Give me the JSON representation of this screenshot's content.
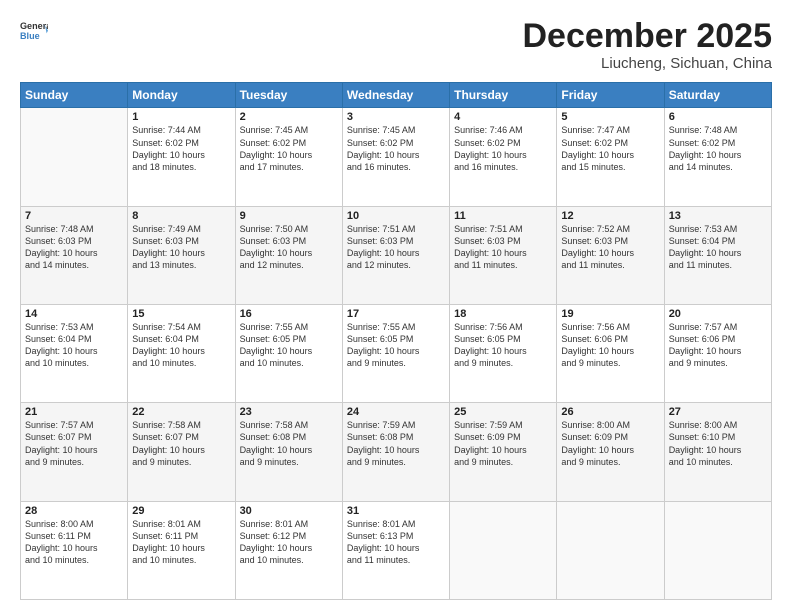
{
  "header": {
    "logo_general": "General",
    "logo_blue": "Blue",
    "month": "December 2025",
    "location": "Liucheng, Sichuan, China"
  },
  "weekdays": [
    "Sunday",
    "Monday",
    "Tuesday",
    "Wednesday",
    "Thursday",
    "Friday",
    "Saturday"
  ],
  "weeks": [
    [
      {
        "day": "",
        "info": ""
      },
      {
        "day": "1",
        "info": "Sunrise: 7:44 AM\nSunset: 6:02 PM\nDaylight: 10 hours\nand 18 minutes."
      },
      {
        "day": "2",
        "info": "Sunrise: 7:45 AM\nSunset: 6:02 PM\nDaylight: 10 hours\nand 17 minutes."
      },
      {
        "day": "3",
        "info": "Sunrise: 7:45 AM\nSunset: 6:02 PM\nDaylight: 10 hours\nand 16 minutes."
      },
      {
        "day": "4",
        "info": "Sunrise: 7:46 AM\nSunset: 6:02 PM\nDaylight: 10 hours\nand 16 minutes."
      },
      {
        "day": "5",
        "info": "Sunrise: 7:47 AM\nSunset: 6:02 PM\nDaylight: 10 hours\nand 15 minutes."
      },
      {
        "day": "6",
        "info": "Sunrise: 7:48 AM\nSunset: 6:02 PM\nDaylight: 10 hours\nand 14 minutes."
      }
    ],
    [
      {
        "day": "7",
        "info": "Sunrise: 7:48 AM\nSunset: 6:03 PM\nDaylight: 10 hours\nand 14 minutes."
      },
      {
        "day": "8",
        "info": "Sunrise: 7:49 AM\nSunset: 6:03 PM\nDaylight: 10 hours\nand 13 minutes."
      },
      {
        "day": "9",
        "info": "Sunrise: 7:50 AM\nSunset: 6:03 PM\nDaylight: 10 hours\nand 12 minutes."
      },
      {
        "day": "10",
        "info": "Sunrise: 7:51 AM\nSunset: 6:03 PM\nDaylight: 10 hours\nand 12 minutes."
      },
      {
        "day": "11",
        "info": "Sunrise: 7:51 AM\nSunset: 6:03 PM\nDaylight: 10 hours\nand 11 minutes."
      },
      {
        "day": "12",
        "info": "Sunrise: 7:52 AM\nSunset: 6:03 PM\nDaylight: 10 hours\nand 11 minutes."
      },
      {
        "day": "13",
        "info": "Sunrise: 7:53 AM\nSunset: 6:04 PM\nDaylight: 10 hours\nand 11 minutes."
      }
    ],
    [
      {
        "day": "14",
        "info": "Sunrise: 7:53 AM\nSunset: 6:04 PM\nDaylight: 10 hours\nand 10 minutes."
      },
      {
        "day": "15",
        "info": "Sunrise: 7:54 AM\nSunset: 6:04 PM\nDaylight: 10 hours\nand 10 minutes."
      },
      {
        "day": "16",
        "info": "Sunrise: 7:55 AM\nSunset: 6:05 PM\nDaylight: 10 hours\nand 10 minutes."
      },
      {
        "day": "17",
        "info": "Sunrise: 7:55 AM\nSunset: 6:05 PM\nDaylight: 10 hours\nand 9 minutes."
      },
      {
        "day": "18",
        "info": "Sunrise: 7:56 AM\nSunset: 6:05 PM\nDaylight: 10 hours\nand 9 minutes."
      },
      {
        "day": "19",
        "info": "Sunrise: 7:56 AM\nSunset: 6:06 PM\nDaylight: 10 hours\nand 9 minutes."
      },
      {
        "day": "20",
        "info": "Sunrise: 7:57 AM\nSunset: 6:06 PM\nDaylight: 10 hours\nand 9 minutes."
      }
    ],
    [
      {
        "day": "21",
        "info": "Sunrise: 7:57 AM\nSunset: 6:07 PM\nDaylight: 10 hours\nand 9 minutes."
      },
      {
        "day": "22",
        "info": "Sunrise: 7:58 AM\nSunset: 6:07 PM\nDaylight: 10 hours\nand 9 minutes."
      },
      {
        "day": "23",
        "info": "Sunrise: 7:58 AM\nSunset: 6:08 PM\nDaylight: 10 hours\nand 9 minutes."
      },
      {
        "day": "24",
        "info": "Sunrise: 7:59 AM\nSunset: 6:08 PM\nDaylight: 10 hours\nand 9 minutes."
      },
      {
        "day": "25",
        "info": "Sunrise: 7:59 AM\nSunset: 6:09 PM\nDaylight: 10 hours\nand 9 minutes."
      },
      {
        "day": "26",
        "info": "Sunrise: 8:00 AM\nSunset: 6:09 PM\nDaylight: 10 hours\nand 9 minutes."
      },
      {
        "day": "27",
        "info": "Sunrise: 8:00 AM\nSunset: 6:10 PM\nDaylight: 10 hours\nand 10 minutes."
      }
    ],
    [
      {
        "day": "28",
        "info": "Sunrise: 8:00 AM\nSunset: 6:11 PM\nDaylight: 10 hours\nand 10 minutes."
      },
      {
        "day": "29",
        "info": "Sunrise: 8:01 AM\nSunset: 6:11 PM\nDaylight: 10 hours\nand 10 minutes."
      },
      {
        "day": "30",
        "info": "Sunrise: 8:01 AM\nSunset: 6:12 PM\nDaylight: 10 hours\nand 10 minutes."
      },
      {
        "day": "31",
        "info": "Sunrise: 8:01 AM\nSunset: 6:13 PM\nDaylight: 10 hours\nand 11 minutes."
      },
      {
        "day": "",
        "info": ""
      },
      {
        "day": "",
        "info": ""
      },
      {
        "day": "",
        "info": ""
      }
    ]
  ]
}
